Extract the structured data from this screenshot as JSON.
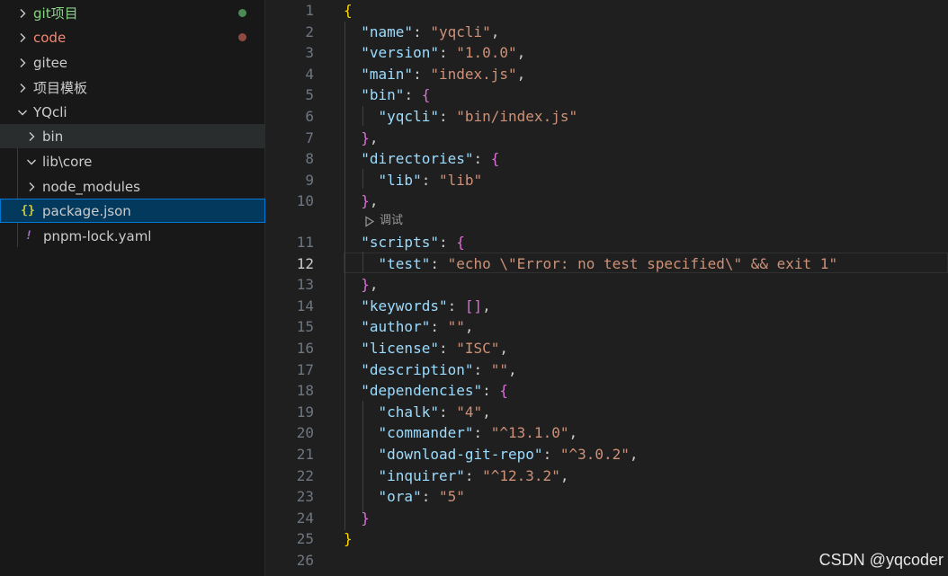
{
  "explorer": {
    "items": [
      {
        "label": "git项目",
        "icon": "chevron-right-icon",
        "color": "#89d185",
        "dot": "#4b8a55"
      },
      {
        "label": "code",
        "icon": "chevron-right-icon",
        "color": "#f48771",
        "dot": "#8f4a42"
      },
      {
        "label": "gitee",
        "icon": "chevron-right-icon"
      },
      {
        "label": "项目模板",
        "icon": "chevron-right-icon"
      },
      {
        "label": "YQcli",
        "icon": "chevron-down-icon"
      },
      {
        "label": "bin",
        "icon": "chevron-right-icon"
      },
      {
        "label": "lib\\core",
        "icon": "chevron-down-icon"
      },
      {
        "label": "node_modules",
        "icon": "chevron-right-icon"
      },
      {
        "label": "package.json",
        "icon": "json-file-icon",
        "glyph": "{}",
        "glyph_color": "#cbcb41"
      },
      {
        "label": "pnpm-lock.yaml",
        "icon": "yaml-file-icon",
        "glyph": "!",
        "glyph_color": "#a074c4"
      }
    ]
  },
  "editor": {
    "codelens": "调试",
    "active_line": 12,
    "lines": [
      {
        "n": "1",
        "t": [
          [
            "b1",
            "{"
          ]
        ]
      },
      {
        "n": "2",
        "t": [
          [
            "pun",
            "  "
          ],
          [
            "key",
            "\"name\""
          ],
          [
            "pun",
            ": "
          ],
          [
            "str",
            "\"yqcli\""
          ],
          [
            "pun",
            ","
          ]
        ]
      },
      {
        "n": "3",
        "t": [
          [
            "pun",
            "  "
          ],
          [
            "key",
            "\"version\""
          ],
          [
            "pun",
            ": "
          ],
          [
            "str",
            "\"1.0.0\""
          ],
          [
            "pun",
            ","
          ]
        ]
      },
      {
        "n": "4",
        "t": [
          [
            "pun",
            "  "
          ],
          [
            "key",
            "\"main\""
          ],
          [
            "pun",
            ": "
          ],
          [
            "str",
            "\"index.js\""
          ],
          [
            "pun",
            ","
          ]
        ]
      },
      {
        "n": "5",
        "t": [
          [
            "pun",
            "  "
          ],
          [
            "key",
            "\"bin\""
          ],
          [
            "pun",
            ": "
          ],
          [
            "b2",
            "{"
          ]
        ]
      },
      {
        "n": "6",
        "t": [
          [
            "pun",
            "    "
          ],
          [
            "key",
            "\"yqcli\""
          ],
          [
            "pun",
            ": "
          ],
          [
            "str",
            "\"bin/index.js\""
          ]
        ]
      },
      {
        "n": "7",
        "t": [
          [
            "pun",
            "  "
          ],
          [
            "b2",
            "}"
          ],
          [
            "pun",
            ","
          ]
        ]
      },
      {
        "n": "8",
        "t": [
          [
            "pun",
            "  "
          ],
          [
            "key",
            "\"directories\""
          ],
          [
            "pun",
            ": "
          ],
          [
            "b2",
            "{"
          ]
        ]
      },
      {
        "n": "9",
        "t": [
          [
            "pun",
            "    "
          ],
          [
            "key",
            "\"lib\""
          ],
          [
            "pun",
            ": "
          ],
          [
            "str",
            "\"lib\""
          ]
        ]
      },
      {
        "n": "10",
        "t": [
          [
            "pun",
            "  "
          ],
          [
            "b2",
            "}"
          ],
          [
            "pun",
            ","
          ]
        ]
      },
      {
        "n": "11",
        "t": [
          [
            "pun",
            "  "
          ],
          [
            "key",
            "\"scripts\""
          ],
          [
            "pun",
            ": "
          ],
          [
            "b2",
            "{"
          ]
        ]
      },
      {
        "n": "12",
        "t": [
          [
            "pun",
            "    "
          ],
          [
            "key",
            "\"test\""
          ],
          [
            "pun",
            ": "
          ],
          [
            "str",
            "\"echo \\\"Error: no test specified\\\" && exit 1\""
          ]
        ]
      },
      {
        "n": "13",
        "t": [
          [
            "pun",
            "  "
          ],
          [
            "b2",
            "}"
          ],
          [
            "pun",
            ","
          ]
        ]
      },
      {
        "n": "14",
        "t": [
          [
            "pun",
            "  "
          ],
          [
            "key",
            "\"keywords\""
          ],
          [
            "pun",
            ": "
          ],
          [
            "b2",
            "[]"
          ],
          [
            "pun",
            ","
          ]
        ]
      },
      {
        "n": "15",
        "t": [
          [
            "pun",
            "  "
          ],
          [
            "key",
            "\"author\""
          ],
          [
            "pun",
            ": "
          ],
          [
            "str",
            "\"\""
          ],
          [
            "pun",
            ","
          ]
        ]
      },
      {
        "n": "16",
        "t": [
          [
            "pun",
            "  "
          ],
          [
            "key",
            "\"license\""
          ],
          [
            "pun",
            ": "
          ],
          [
            "str",
            "\"ISC\""
          ],
          [
            "pun",
            ","
          ]
        ]
      },
      {
        "n": "17",
        "t": [
          [
            "pun",
            "  "
          ],
          [
            "key",
            "\"description\""
          ],
          [
            "pun",
            ": "
          ],
          [
            "str",
            "\"\""
          ],
          [
            "pun",
            ","
          ]
        ]
      },
      {
        "n": "18",
        "t": [
          [
            "pun",
            "  "
          ],
          [
            "key",
            "\"dependencies\""
          ],
          [
            "pun",
            ": "
          ],
          [
            "b2",
            "{"
          ]
        ]
      },
      {
        "n": "19",
        "t": [
          [
            "pun",
            "    "
          ],
          [
            "key",
            "\"chalk\""
          ],
          [
            "pun",
            ": "
          ],
          [
            "str",
            "\"4\""
          ],
          [
            "pun",
            ","
          ]
        ]
      },
      {
        "n": "20",
        "t": [
          [
            "pun",
            "    "
          ],
          [
            "key",
            "\"commander\""
          ],
          [
            "pun",
            ": "
          ],
          [
            "str",
            "\"^13.1.0\""
          ],
          [
            "pun",
            ","
          ]
        ]
      },
      {
        "n": "21",
        "t": [
          [
            "pun",
            "    "
          ],
          [
            "key",
            "\"download-git-repo\""
          ],
          [
            "pun",
            ": "
          ],
          [
            "str",
            "\"^3.0.2\""
          ],
          [
            "pun",
            ","
          ]
        ]
      },
      {
        "n": "22",
        "t": [
          [
            "pun",
            "    "
          ],
          [
            "key",
            "\"inquirer\""
          ],
          [
            "pun",
            ": "
          ],
          [
            "str",
            "\"^12.3.2\""
          ],
          [
            "pun",
            ","
          ]
        ]
      },
      {
        "n": "23",
        "t": [
          [
            "pun",
            "    "
          ],
          [
            "key",
            "\"ora\""
          ],
          [
            "pun",
            ": "
          ],
          [
            "str",
            "\"5\""
          ]
        ]
      },
      {
        "n": "24",
        "t": [
          [
            "pun",
            "  "
          ],
          [
            "b2",
            "}"
          ]
        ]
      },
      {
        "n": "25",
        "t": [
          [
            "b1",
            "}"
          ]
        ]
      },
      {
        "n": "26",
        "t": []
      }
    ]
  },
  "watermark": "CSDN @yqcoder"
}
